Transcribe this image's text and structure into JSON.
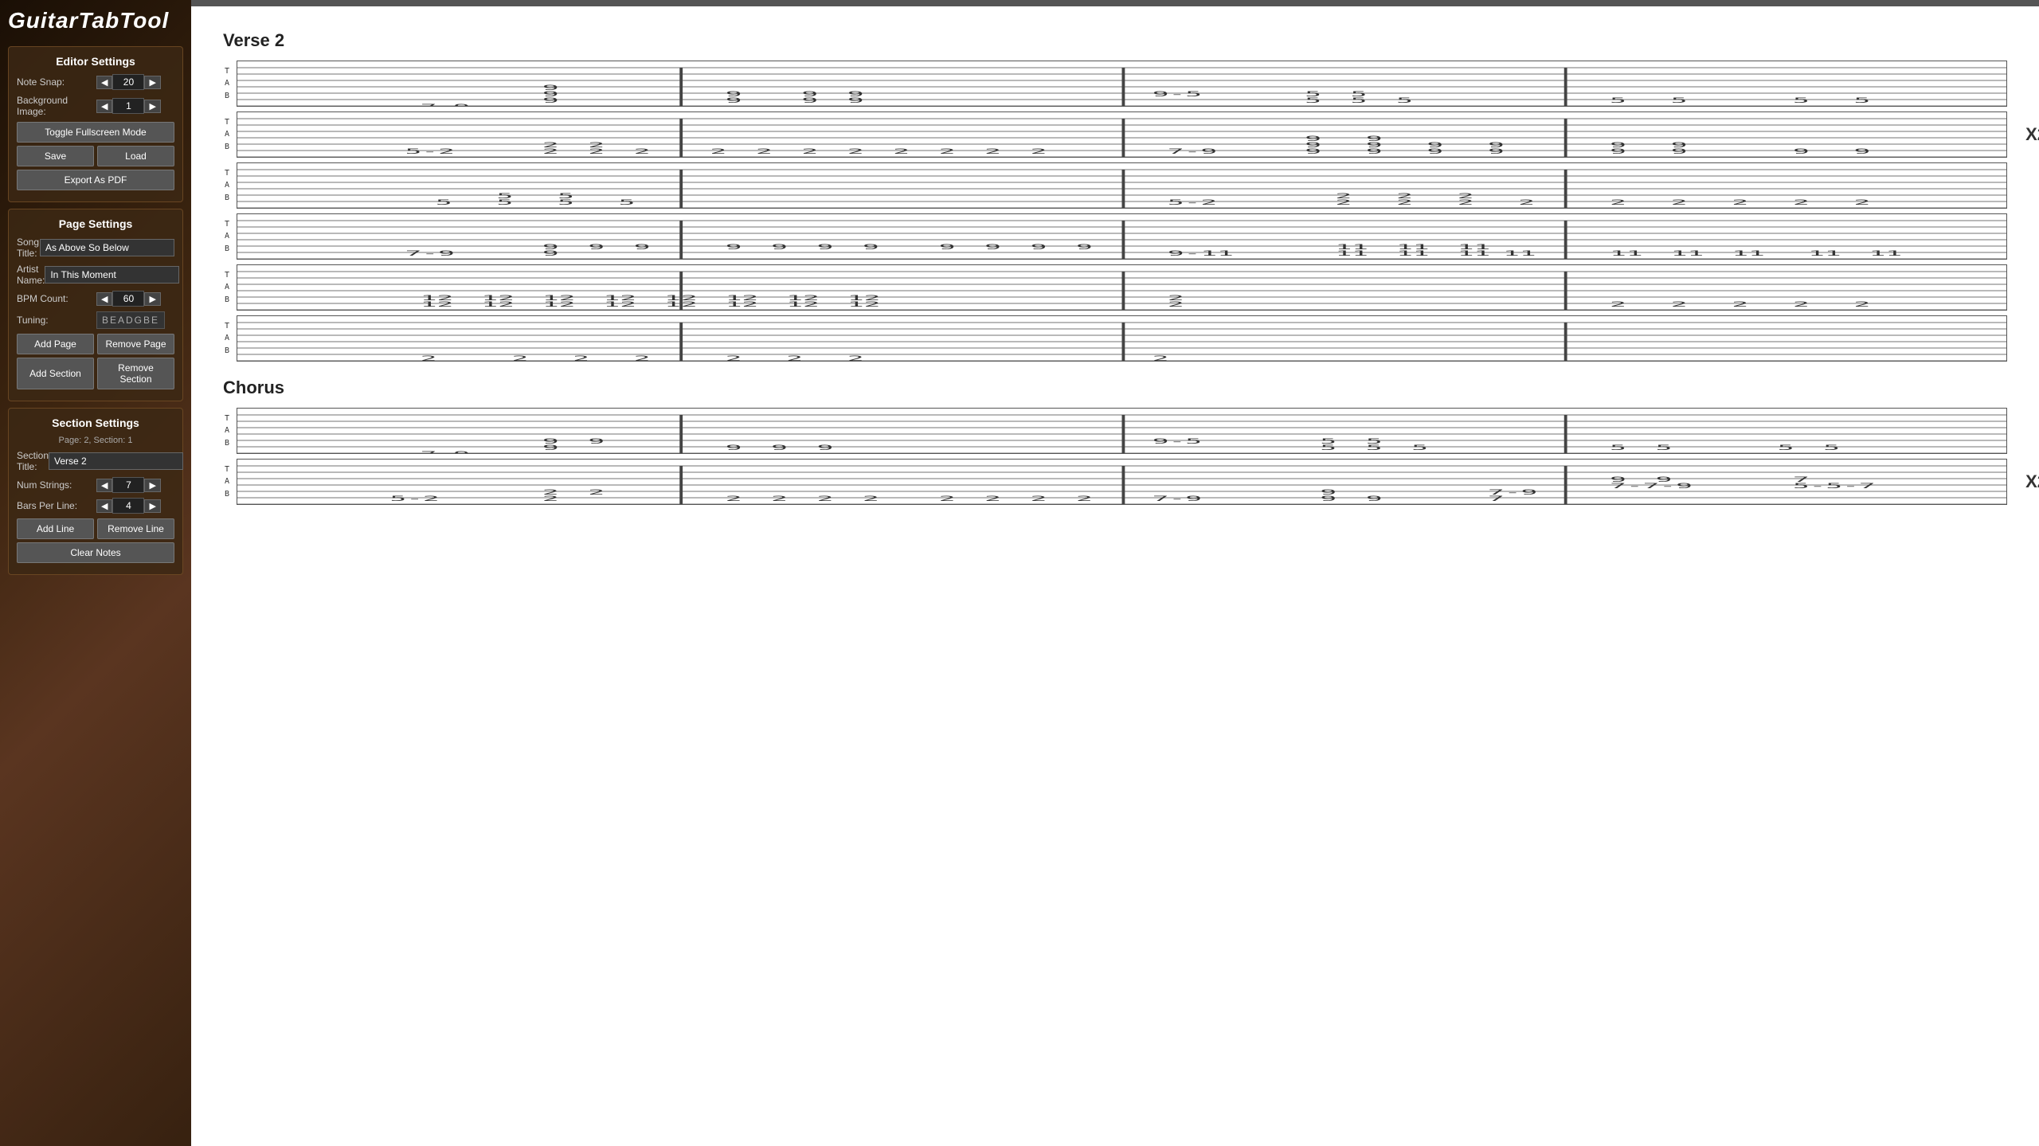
{
  "app": {
    "title": "GuitarTabTool"
  },
  "editor_settings": {
    "title": "Editor Settings",
    "note_snap_label": "Note Snap:",
    "note_snap_value": "20",
    "background_image_label": "Background Image:",
    "background_image_value": "1",
    "toggle_fullscreen_label": "Toggle Fullscreen Mode",
    "save_label": "Save",
    "load_label": "Load",
    "export_label": "Export As PDF"
  },
  "page_settings": {
    "title": "Page Settings",
    "song_title_label": "Song Title:",
    "song_title_value": "As Above So Below",
    "artist_name_label": "Artist Name:",
    "artist_name_value": "In This Moment",
    "bpm_label": "BPM Count:",
    "bpm_value": "60",
    "tuning_label": "Tuning:",
    "tuning_value": "BEADGBE",
    "add_page_label": "Add Page",
    "remove_page_label": "Remove Page",
    "add_section_label": "Add Section",
    "remove_section_label": "Remove Section"
  },
  "section_settings": {
    "title": "Section Settings",
    "page_info": "Page: 2, Section: 1",
    "section_title_label": "Section Title:",
    "section_title_value": "Verse 2",
    "num_strings_label": "Num Strings:",
    "num_strings_value": "7",
    "bars_per_line_label": "Bars Per Line:",
    "bars_per_line_value": "4",
    "add_line_label": "Add Line",
    "remove_line_label": "Remove Line",
    "clear_notes_label": "Clear Notes"
  },
  "tab_display": {
    "verse2_title": "Verse 2",
    "chorus_title": "Chorus"
  }
}
